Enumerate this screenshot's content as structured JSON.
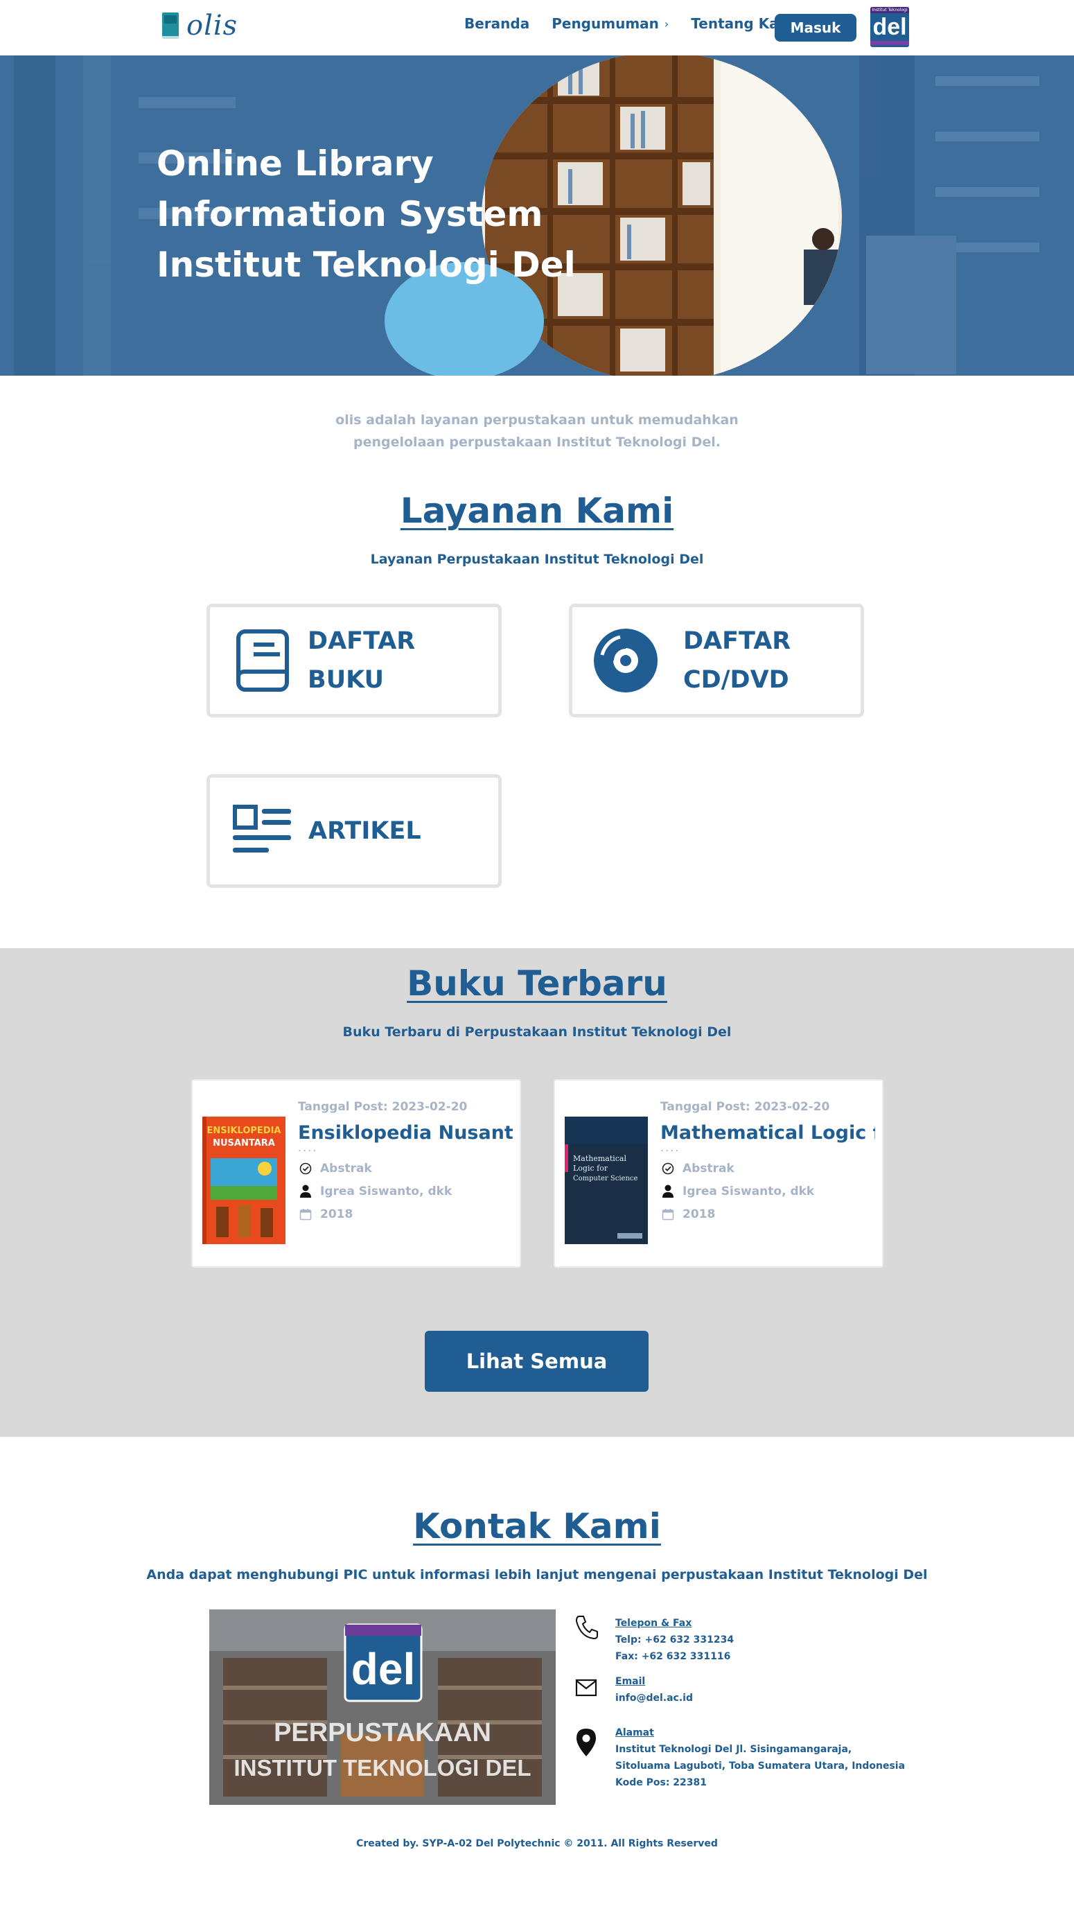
{
  "navbar": {
    "brand": "olis",
    "items": [
      {
        "label": "Beranda"
      },
      {
        "label": "Pengumuman"
      },
      {
        "label": "Tentang Kami"
      }
    ],
    "login_label": "Masuk",
    "badge_text": "del",
    "badge_caption": "Institut Teknologi"
  },
  "hero": {
    "title_line1": "Online Library",
    "title_line2": "Information System",
    "title_line3": "Institut Teknologi Del"
  },
  "intro": {
    "line1": "olis adalah layanan perpustakaan  untuk memudahkan",
    "line2": "pengelolaan perpustakaan Institut Teknologi Del."
  },
  "layanan": {
    "title": "Layanan Kami",
    "subtitle": "Layanan Perpustakaan Institut Teknologi Del",
    "items": [
      {
        "label": "DAFTAR BUKU",
        "icon": "book-icon"
      },
      {
        "label_line1": "DAFTAR",
        "label_line2": "CD/DVD",
        "icon": "disc-icon"
      },
      {
        "label": "ARTIKEL",
        "icon": "article-icon"
      }
    ]
  },
  "buku": {
    "title": "Buku Terbaru",
    "subtitle": "Buku Terbaru di Perpustakaan Institut Teknologi Del",
    "books": [
      {
        "date": "Tanggal Post: 2023-02-20",
        "title": "Ensiklopedia Nusantara",
        "dots": "....",
        "abstract": "Abstrak",
        "author": "Igrea Siswanto, dkk",
        "year": "2018",
        "cover_line1": "ENSIKLOPEDIA",
        "cover_line2": "NUSANTARA"
      },
      {
        "date": "Tanggal Post: 2023-02-20",
        "title": "Mathematical Logic for",
        "dots": "....",
        "abstract": "Abstrak",
        "author": "Igrea Siswanto, dkk",
        "year": "2018",
        "cover_line1": "Mathematical",
        "cover_line2": "Logic for",
        "cover_line3": "Computer Science"
      }
    ],
    "see_all_label": "Lihat Semua"
  },
  "kontak": {
    "title": "Kontak Kami",
    "subtitle": "Anda dapat menghubungi PIC untuk informasi lebih lanjut mengenai perpustakaan Institut Teknologi Del",
    "photo_badge": "del",
    "photo_line1": "PERPUSTAKAAN",
    "photo_line2": "INSTITUT TEKNOLOGI DEL",
    "phone_head": "Telepon & Fax",
    "phone_line1": "Telp: +62 632 331234",
    "phone_line2": "Fax: +62 632 331116",
    "email_head": "Email",
    "email_value": "info@del.ac.id",
    "address_head": "Alamat",
    "address_line1": "Institut Teknologi Del Jl. Sisingamangaraja,",
    "address_line2": "Sitoluama Laguboti, Toba Sumatera Utara, Indonesia",
    "address_line3": "Kode Pos: 22381"
  },
  "footer": {
    "text": "Created by. SYP-A-02 Del Polytechnic © 2011. All Rights Reserved"
  },
  "colors": {
    "brand": "#1f5d93",
    "muted": "#a7b3c6",
    "gray_band": "#d9d9d9"
  }
}
